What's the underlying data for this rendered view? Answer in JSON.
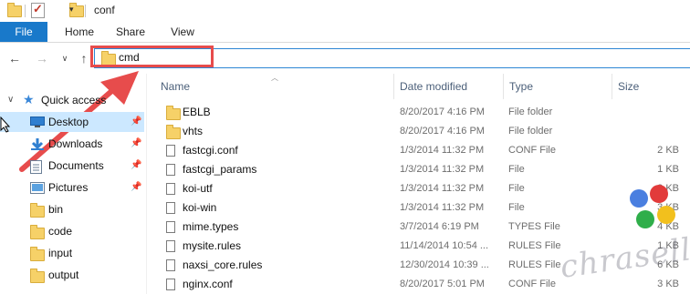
{
  "window": {
    "title": "conf"
  },
  "ribbon": {
    "tabs": [
      "File",
      "Home",
      "Share",
      "View"
    ]
  },
  "address": {
    "value": "cmd"
  },
  "sidebar": {
    "quick_access_label": "Quick access",
    "items": [
      {
        "label": "Desktop",
        "icon": "desktop-icon",
        "pinned": true
      },
      {
        "label": "Downloads",
        "icon": "download-icon",
        "pinned": true
      },
      {
        "label": "Documents",
        "icon": "documents-icon",
        "pinned": true
      },
      {
        "label": "Pictures",
        "icon": "pictures-icon",
        "pinned": true
      },
      {
        "label": "bin",
        "icon": "folder-icon",
        "pinned": false
      },
      {
        "label": "code",
        "icon": "folder-icon",
        "pinned": false
      },
      {
        "label": "input",
        "icon": "folder-icon",
        "pinned": false
      },
      {
        "label": "output",
        "icon": "folder-icon",
        "pinned": false
      }
    ]
  },
  "columns": {
    "name": "Name",
    "date": "Date modified",
    "type": "Type",
    "size": "Size"
  },
  "files": [
    {
      "name": "EBLB",
      "date": "8/20/2017 4:16 PM",
      "type": "File folder",
      "size": "",
      "icon": "folder-icon"
    },
    {
      "name": "vhts",
      "date": "8/20/2017 4:16 PM",
      "type": "File folder",
      "size": "",
      "icon": "folder-icon"
    },
    {
      "name": "fastcgi.conf",
      "date": "1/3/2014 11:32 PM",
      "type": "CONF File",
      "size": "2 KB",
      "icon": "file-icon"
    },
    {
      "name": "fastcgi_params",
      "date": "1/3/2014 11:32 PM",
      "type": "File",
      "size": "1 KB",
      "icon": "file-icon"
    },
    {
      "name": "koi-utf",
      "date": "1/3/2014 11:32 PM",
      "type": "File",
      "size": "3 KB",
      "icon": "file-icon"
    },
    {
      "name": "koi-win",
      "date": "1/3/2014 11:32 PM",
      "type": "File",
      "size": "3 KB",
      "icon": "file-icon"
    },
    {
      "name": "mime.types",
      "date": "3/7/2014 6:19 PM",
      "type": "TYPES File",
      "size": "4 KB",
      "icon": "file-icon"
    },
    {
      "name": "mysite.rules",
      "date": "11/14/2014 10:54 ...",
      "type": "RULES File",
      "size": "1 KB",
      "icon": "file-icon"
    },
    {
      "name": "naxsi_core.rules",
      "date": "12/30/2014 10:39 ...",
      "type": "RULES File",
      "size": "6 KB",
      "icon": "file-icon"
    },
    {
      "name": "nginx.conf",
      "date": "8/20/2017 5:01 PM",
      "type": "CONF File",
      "size": "3 KB",
      "icon": "file-icon"
    }
  ],
  "watermark": {
    "text": "chrasell.com"
  },
  "colors": {
    "accent": "#1979ca",
    "annotation": "#e74c4c",
    "selection": "#cce8ff",
    "folder": "#f6d168"
  }
}
